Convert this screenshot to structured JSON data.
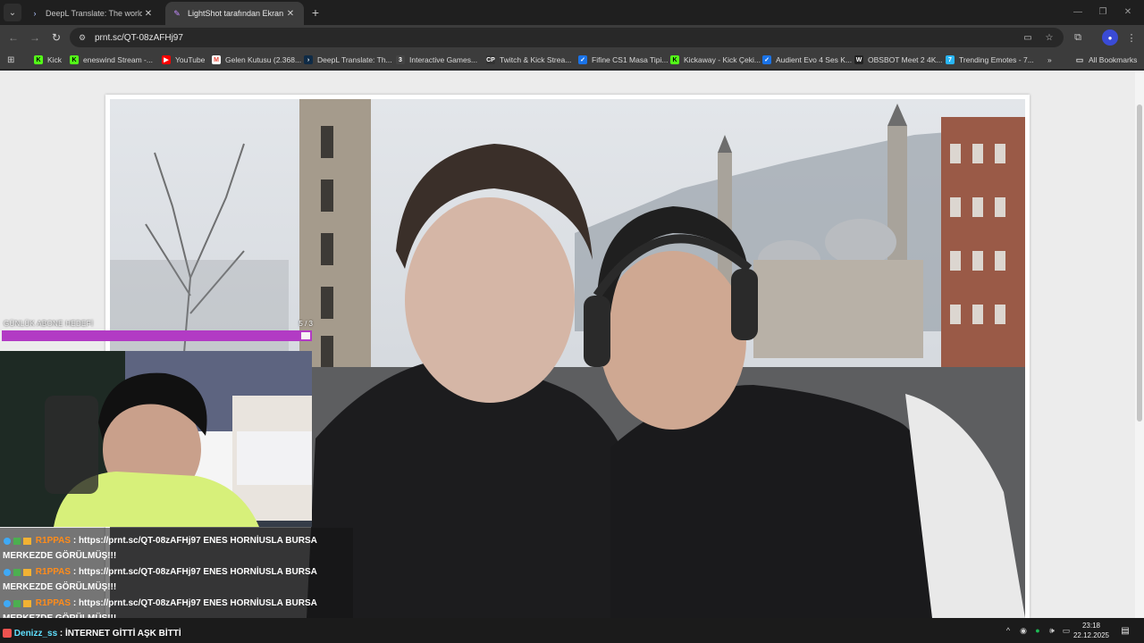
{
  "browser": {
    "tabs": [
      {
        "label": "DeepL Translate: The world's m",
        "icon": "deepl-icon",
        "active": false
      },
      {
        "label": "LightShot tarafından Ekran Gör",
        "icon": "lightshot-icon",
        "active": true
      }
    ],
    "url": "prnt.sc/QT-08zAFHj97",
    "bookmarks": [
      {
        "label": "Kick",
        "icon": "kick-icon",
        "color": "#53fc18"
      },
      {
        "label": "eneswind Stream -...",
        "icon": "kick-icon",
        "color": "#53fc18"
      },
      {
        "label": "YouTube",
        "icon": "youtube-icon",
        "color": "#ff0000"
      },
      {
        "label": "Gelen Kutusu (2.368...",
        "icon": "gmail-icon",
        "color": "#ea4335"
      },
      {
        "label": "DeepL Translate: Th...",
        "icon": "deepl-icon",
        "color": "#0f2b46"
      },
      {
        "label": "Interactive Games...",
        "icon": "games-icon",
        "color": "#444444"
      },
      {
        "label": "Twitch & Kick Strea...",
        "icon": "cp-icon",
        "color": "#333333"
      },
      {
        "label": "Fifine CS1 Masa Tipi...",
        "icon": "check-icon",
        "color": "#1a73e8"
      },
      {
        "label": "Kickaway - Kick Çeki...",
        "icon": "kick-icon",
        "color": "#53fc18"
      },
      {
        "label": "Audient Evo 4 Ses K...",
        "icon": "check-icon",
        "color": "#1a73e8"
      },
      {
        "label": "OBSBOT Meet 2 4K...",
        "icon": "obsbot-icon",
        "color": "#222222"
      },
      {
        "label": "Trending Emotes - 7...",
        "icon": "7tv-icon",
        "color": "#29b6f6"
      }
    ],
    "all_bookmarks_label": "All Bookmarks"
  },
  "overlay": {
    "goal_label": "GÜNLÜK ABONE HEDEFİ",
    "goal_count": "5 / 3",
    "goal_progress": 0.97,
    "goal_color": "#b23bc4"
  },
  "chat": {
    "messages": [
      {
        "user": "R1PPAS",
        "text": ": https://prnt.sc/QT-08zAFHj97 ENES HORNİUSLA BURSA MERKEZDE GÖRÜLMÜŞ!!!"
      },
      {
        "user": "R1PPAS",
        "text": ": https://prnt.sc/QT-08zAFHj97 ENES HORNİUSLA BURSA MERKEZDE GÖRÜLMÜŞ!!!"
      },
      {
        "user": "R1PPAS",
        "text": ": https://prnt.sc/QT-08zAFHj97 ENES HORNİUSLA BURSA MERKEZDE GÖRÜLMÜŞ!!!"
      }
    ],
    "last_user": "Denizz_ss",
    "last_text": ": İNTERNET GİTTİ AŞK BİTTİ"
  },
  "taskbar": {
    "time": "23:18",
    "date": "22.12.2025"
  }
}
